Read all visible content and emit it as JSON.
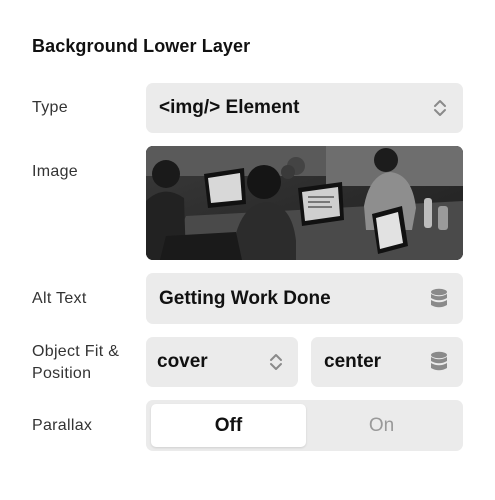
{
  "section": {
    "title": "Background Lower Layer"
  },
  "type_row": {
    "label": "Type",
    "value": "<img/> Element",
    "icon": "chevron-up-down-icon"
  },
  "image_row": {
    "label": "Image"
  },
  "alt_row": {
    "label": "Alt Text",
    "value": "Getting Work Done",
    "icon": "database-icon"
  },
  "fit_row": {
    "label_line1": "Object Fit &",
    "label_line2": "Position",
    "fit_value": "cover",
    "fit_icon": "chevron-up-down-icon",
    "position_value": "center",
    "position_icon": "database-icon"
  },
  "parallax_row": {
    "label": "Parallax",
    "options": [
      "Off",
      "On"
    ],
    "selected": "Off"
  },
  "colors": {
    "control_bg": "#ebebeb",
    "text": "#111111",
    "label": "#333333",
    "muted": "#999999",
    "icon": "#8a8a8a"
  }
}
